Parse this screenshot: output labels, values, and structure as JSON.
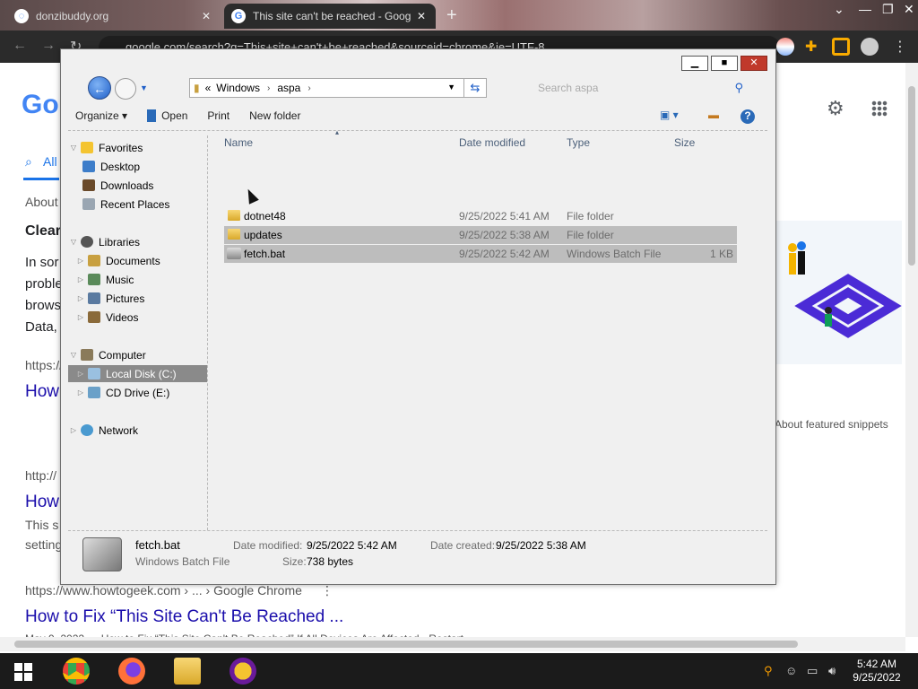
{
  "browser": {
    "tabs": [
      {
        "title": "donzibuddy.org",
        "active": false
      },
      {
        "title": "This site can't be reached - Goog",
        "active": true
      }
    ],
    "new_tab": "+",
    "url": "google.com/search?q=This+site+can't+be+reached&sourceid=chrome&ie=UTF-8",
    "google_logo": "Go",
    "tab_all": "All",
    "results": {
      "about": "About",
      "snippet_title": "Clear",
      "snippet_lines": [
        "In sor",
        "proble",
        "brows",
        "Data,"
      ],
      "url1": "https://",
      "link1": "How",
      "url2": "http://",
      "link2": "How",
      "desc2_lines": [
        "This s",
        "setting"
      ],
      "featured_note": "About featured snippets",
      "url3": "https://www.howtogeek.com › ... › Google Chrome",
      "menu3": "⋮",
      "link3": "How to Fix “This Site Can't Be Reached ...",
      "desc3": "May 9, 2022 — How to Fix “This Site Can't Be Reached” If All Devices Are Affected · Restart"
    }
  },
  "explorer": {
    "window_buttons": {
      "minimize": "▁",
      "maximize": "■",
      "close": "✕"
    },
    "address": {
      "prefix": "«",
      "parts": [
        "Windows",
        "aspa"
      ],
      "sep": "›"
    },
    "search_placeholder": "Search aspa",
    "toolbar": {
      "organize": "Organize ▾",
      "open": "Open",
      "print": "Print",
      "new_folder": "New folder"
    },
    "nav": {
      "favorites": "Favorites",
      "desktop": "Desktop",
      "downloads": "Downloads",
      "recent": "Recent Places",
      "libraries": "Libraries",
      "documents": "Documents",
      "music": "Music",
      "pictures": "Pictures",
      "videos": "Videos",
      "computer": "Computer",
      "local_disk": "Local Disk (C:)",
      "cd_drive": "CD Drive (E:)",
      "network": "Network"
    },
    "columns": {
      "name": "Name",
      "date": "Date modified",
      "type": "Type",
      "size": "Size"
    },
    "files": [
      {
        "name": "dotnet48",
        "date": "9/25/2022 5:41 AM",
        "type": "File folder",
        "size": "",
        "kind": "folder",
        "selected": false
      },
      {
        "name": "updates",
        "date": "9/25/2022 5:38 AM",
        "type": "File folder",
        "size": "",
        "kind": "folder",
        "selected": true
      },
      {
        "name": "fetch.bat",
        "date": "9/25/2022 5:42 AM",
        "type": "Windows Batch File",
        "size": "1 KB",
        "kind": "bat",
        "selected": true
      }
    ],
    "details": {
      "name": "fetch.bat",
      "type": "Windows Batch File",
      "date_modified_label": "Date modified:",
      "date_modified": "9/25/2022 5:42 AM",
      "date_created_label": "Date created:",
      "date_created": "9/25/2022 5:38 AM",
      "size_label": "Size:",
      "size": "738 bytes"
    }
  },
  "taskbar": {
    "clock_time": "5:42 AM",
    "clock_date": "9/25/2022"
  },
  "colors": {
    "explorer_bg": "#f0f0f0",
    "selection": "#bdbdbd",
    "link_blue": "#1a0dab",
    "taskbar": "#1b1b1b"
  }
}
